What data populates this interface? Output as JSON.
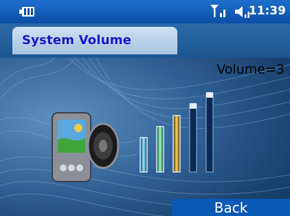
{
  "statusbar": {
    "time": "11:39",
    "icons": [
      "battery-icon",
      "signal-icon",
      "speaker-icon"
    ]
  },
  "screen": {
    "title": "System Volume",
    "volume_readout": "Volume=3",
    "volume_level": 3,
    "volume_max": 5
  },
  "softkey": {
    "right_label": "Back"
  },
  "colors": {
    "statusbar": "#0b4fa7",
    "title_text": "#1a16c8",
    "softkey_bg": "#0b59b7",
    "background": "#2e5f94"
  }
}
